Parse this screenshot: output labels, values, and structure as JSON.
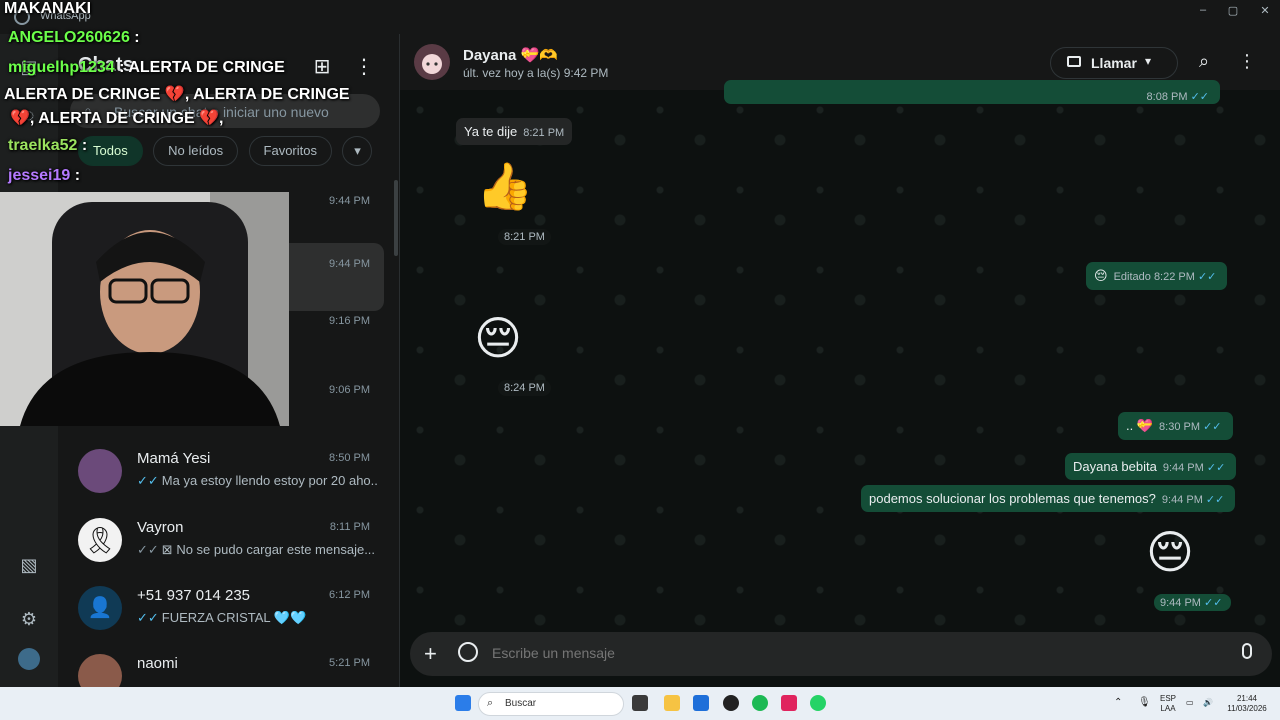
{
  "window": {
    "app_name": "WhatsApp",
    "controls": [
      "–",
      "▢",
      "✕"
    ]
  },
  "chat_list": {
    "title": "Chats",
    "search_placeholder": "Buscar un chat o iniciar uno nuevo",
    "filters": [
      "Todos",
      "No leídos",
      "Favoritos"
    ],
    "chats": [
      {
        "name": "",
        "time": "9:44 PM",
        "preview": "",
        "selected": false
      },
      {
        "name": "",
        "time": "9:44 PM",
        "preview": "",
        "selected": true
      },
      {
        "name": "",
        "time": "9:16 PM",
        "preview": "",
        "selected": false
      },
      {
        "name": "",
        "time": "9:06 PM",
        "preview": "",
        "selected": false
      },
      {
        "name": "Mamá Yesi",
        "time": "8:50 PM",
        "preview": "Ma ya estoy llendo estoy por 20 aho...",
        "tick": "blue"
      },
      {
        "name": "Vayron",
        "time": "8:11 PM",
        "preview": "No se pudo cargar este mensaje...",
        "tick": "grey"
      },
      {
        "name": "+51 937 014 235",
        "time": "6:12 PM",
        "preview": "FUERZA CRISTAL 🩵🩵",
        "tick": "blue"
      },
      {
        "name": "naomi",
        "time": "5:21 PM",
        "preview": "",
        "tick": "none"
      }
    ]
  },
  "conversation": {
    "contact_name": "Dayana 💝🫶",
    "status": "últ. vez hoy a la(s) 9:42 PM",
    "call_label": "Llamar",
    "compose_placeholder": "Escribe un mensaje",
    "messages": [
      {
        "dir": "out",
        "text": "",
        "time": "8:08 PM"
      },
      {
        "dir": "in",
        "text": "Ya te dije",
        "time": "8:21 PM"
      },
      {
        "dir": "in",
        "emoji": "👍",
        "time": "8:21 PM"
      },
      {
        "dir": "out",
        "text": "😔",
        "edited": "Editado",
        "time": "8:22 PM"
      },
      {
        "dir": "in",
        "emoji": "😔",
        "time": "8:24 PM"
      },
      {
        "dir": "out",
        "text": ".. 💝",
        "time": "8:30 PM"
      },
      {
        "dir": "out",
        "text": "Dayana bebita",
        "time": "9:44 PM"
      },
      {
        "dir": "out",
        "text": "podemos solucionar los problemas que tenemos?",
        "time": "9:44 PM"
      },
      {
        "dir": "out",
        "emoji": "😔",
        "time": "9:44 PM"
      }
    ]
  },
  "stream_overlay": {
    "streamer": "MAKANAKI",
    "chat_lines": [
      {
        "user": "ANGELO260626",
        "text": ":",
        "color": "#6cff4a"
      },
      {
        "user": "miguelhp1234",
        "text": ": ALERTA DE CRINGE",
        "color": "#6cff4a"
      },
      {
        "user": "",
        "text": "ALERTA DE CRINGE 💔, ALERTA DE CRINGE",
        "color": "#ffffff"
      },
      {
        "user": "",
        "text": "💔, ALERTA DE CRINGE 💔,",
        "color": "#ffffff"
      },
      {
        "user": "traelka52",
        "text": ":",
        "color": "#9be35f"
      },
      {
        "user": "jessei19",
        "text": ":",
        "color": "#b57aff"
      }
    ]
  },
  "taskbar": {
    "search_placeholder": "Buscar",
    "language": "ESP",
    "language_sub": "LAA",
    "time": "21:44",
    "date": "11/03/2026"
  }
}
